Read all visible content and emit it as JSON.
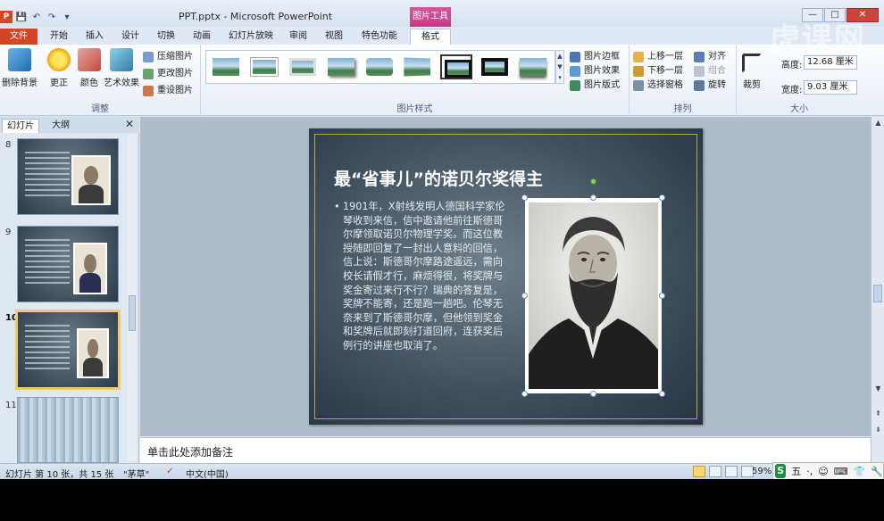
{
  "window": {
    "title": "PPT.pptx - Microsoft PowerPoint",
    "context_tab_header": "图片工具",
    "controls": {
      "minimize": "—",
      "maximize": "□",
      "close": "✕"
    }
  },
  "qat": {
    "logo": "P",
    "save": "💾",
    "undo": "↶",
    "redo": "↷",
    "customize": "▾"
  },
  "tabs": [
    {
      "label": "文件"
    },
    {
      "label": "开始"
    },
    {
      "label": "插入"
    },
    {
      "label": "设计"
    },
    {
      "label": "切换"
    },
    {
      "label": "动画"
    },
    {
      "label": "幻灯片放映"
    },
    {
      "label": "审阅"
    },
    {
      "label": "视图"
    },
    {
      "label": "特色功能"
    },
    {
      "label": "格式"
    }
  ],
  "ribbon": {
    "adjust": {
      "label": "调整",
      "remove_bg": "删除背景",
      "corrections": "更正",
      "color": "颜色",
      "artistic": "艺术效果",
      "compress": "压缩图片",
      "change": "更改图片",
      "reset": "重设图片"
    },
    "styles": {
      "label": "图片样式",
      "border": "图片边框",
      "effects": "图片效果",
      "layout": "图片版式"
    },
    "arrange": {
      "label": "排列",
      "bring_forward": "上移一层",
      "send_backward": "下移一层",
      "selection_pane": "选择窗格",
      "align": "对齐",
      "group": "组合",
      "rotate": "旋转"
    },
    "size": {
      "label": "大小",
      "crop": "裁剪",
      "height_label": "高度:",
      "height_value": "12.68 厘米",
      "width_label": "宽度:",
      "width_value": "9.03 厘米"
    }
  },
  "watermark": "虎课网",
  "left_pane": {
    "tab_slides": "幻灯片",
    "tab_outline": "大纲",
    "close": "✕",
    "slides": [
      {
        "number": "8"
      },
      {
        "number": "9"
      },
      {
        "number": "10"
      },
      {
        "number": "11"
      }
    ]
  },
  "slide": {
    "title": "最“省事儿”的诺贝尔奖得主",
    "bullet": "•",
    "body": "1901年，X射线发明人德国科学家伦琴收到来信，信中邀请他前往斯德哥尔摩领取诺贝尔物理学奖。而这位教授随即回复了一封出人意料的回信，信上说：斯德哥尔摩路途遥远，需向校长请假才行，麻烦得很，将奖牌与奖金寄过来行不行？瑞典的答复是，奖牌不能寄，还是跑一趟吧。伦琴无奈来到了斯德哥尔摩，但他领到奖金和奖牌后就即刻打道回府，连获奖后例行的讲座也取消了。"
  },
  "notes": {
    "placeholder": "单击此处添加备注"
  },
  "status": {
    "slide_info": "幻灯片 第 10 张，共 15 张",
    "theme": "\"茅草\"",
    "language": "中文(中国)",
    "zoom": "59%"
  },
  "ime": {
    "logo": "S",
    "mode": "五",
    "punct": "·,",
    "emoji": "☺",
    "keyboard": "⌨",
    "skin": "👕",
    "settings": "🔧"
  }
}
